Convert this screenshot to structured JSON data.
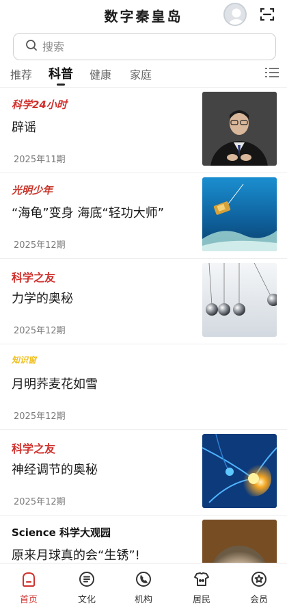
{
  "header": {
    "title": "数字秦皇岛",
    "avatar_icon": "user-avatar-icon",
    "scan_icon": "scan-icon"
  },
  "search": {
    "placeholder": "搜索"
  },
  "tabs": [
    {
      "label": "推荐",
      "active": false
    },
    {
      "label": "科普",
      "active": true
    },
    {
      "label": "健康",
      "active": false
    },
    {
      "label": "家庭",
      "active": false
    }
  ],
  "articles": [
    {
      "source": "科学24小时",
      "title": "辟谣",
      "date": "2025年11期",
      "has_image": true
    },
    {
      "source": "光明少年",
      "title": "“海龟”变身 海底“轻功大师”",
      "date": "2025年12期",
      "has_image": true
    },
    {
      "source": "科学之友",
      "title": "力学的奥秘",
      "date": "2025年12期",
      "has_image": true
    },
    {
      "source": "知识窗",
      "title": "月明荞麦花如雪",
      "date": "2025年12期",
      "has_image": false
    },
    {
      "source": "科学之友",
      "title": "神经调节的奥秘",
      "date": "2025年12期",
      "has_image": true
    },
    {
      "source": "Science 科学大观园",
      "title": "原来月球真的会“生锈”!",
      "date": "",
      "has_image": true
    }
  ],
  "bottom_nav": [
    {
      "label": "首页",
      "icon": "home-icon",
      "active": true
    },
    {
      "label": "文化",
      "icon": "culture-icon",
      "active": false
    },
    {
      "label": "机构",
      "icon": "institution-icon",
      "active": false
    },
    {
      "label": "居民",
      "icon": "residents-icon",
      "active": false
    },
    {
      "label": "会员",
      "icon": "member-icon",
      "active": false
    }
  ],
  "colors": {
    "accent": "#d0312d",
    "text": "#1c1c1c",
    "muted": "#7a7a7a"
  }
}
